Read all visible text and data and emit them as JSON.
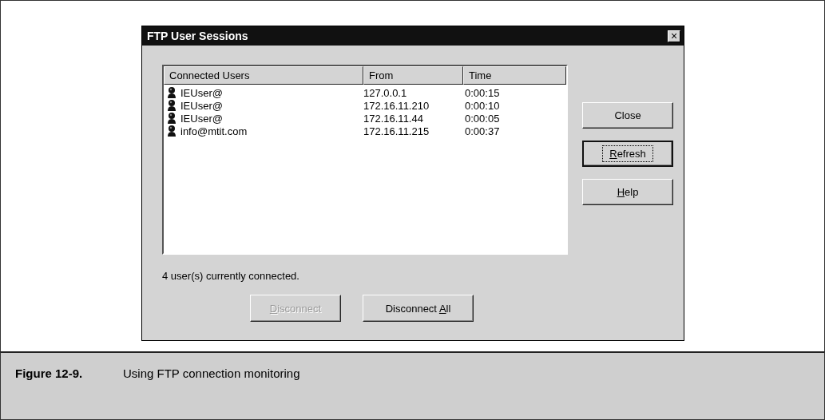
{
  "window": {
    "title": "FTP User Sessions",
    "close": "×"
  },
  "table": {
    "columns": [
      "Connected Users",
      "From",
      "Time"
    ],
    "rows": [
      {
        "user": "IEUser@",
        "from": "127.0.0.1",
        "time": "0:00:15"
      },
      {
        "user": "IEUser@",
        "from": "172.16.11.210",
        "time": "0:00:10"
      },
      {
        "user": "IEUser@",
        "from": "172.16.11.44",
        "time": "0:00:05"
      },
      {
        "user": "info@mtit.com",
        "from": "172.16.11.215",
        "time": "0:00:37"
      }
    ]
  },
  "side_buttons": [
    {
      "pre": "Close",
      "default": false,
      "disabled": false
    },
    {
      "key": "R",
      "post": "efresh",
      "default": true,
      "disabled": false
    },
    {
      "key": "H",
      "post": "elp",
      "default": false,
      "disabled": false
    }
  ],
  "status": "4 user(s) currently connected.",
  "bottom_buttons": [
    {
      "key": "D",
      "post": "isconnect",
      "default": false,
      "disabled": true
    },
    {
      "pre": "Disconnect ",
      "key": "A",
      "post": "ll",
      "default": false,
      "disabled": false
    }
  ],
  "caption": {
    "number": "Figure 12-9.",
    "text": "Using FTP connection monitoring"
  }
}
